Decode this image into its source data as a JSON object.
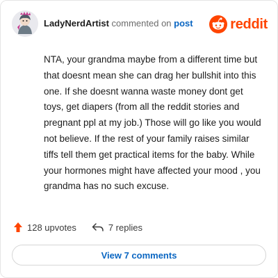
{
  "comment": {
    "username": "LadyNerdArtist",
    "commented_text": " commented on ",
    "post_link": "post",
    "body": "NTA, your grandma maybe from a different time but that doesnt mean she can drag her bullshit into this one. If she doesnt wanna waste money dont get toys, get diapers (from all the reddit stories and pregnant ppl at my job.) Those will go like you would not believe. If the rest of your family raises similar tiffs tell them get practical items for the baby. While your hormones might have affected your mood , you grandma has no such excuse."
  },
  "brand": {
    "name": "reddit",
    "icon": "reddit-snoo-icon",
    "color": "#ff4500"
  },
  "stats": {
    "upvotes_label": "128 upvotes",
    "upvote_icon": "upvote-arrow-icon",
    "upvote_color": "#ff4500",
    "replies_label": "7 replies",
    "reply_icon": "reply-arrow-icon"
  },
  "actions": {
    "view_comments_label": "View 7 comments"
  }
}
